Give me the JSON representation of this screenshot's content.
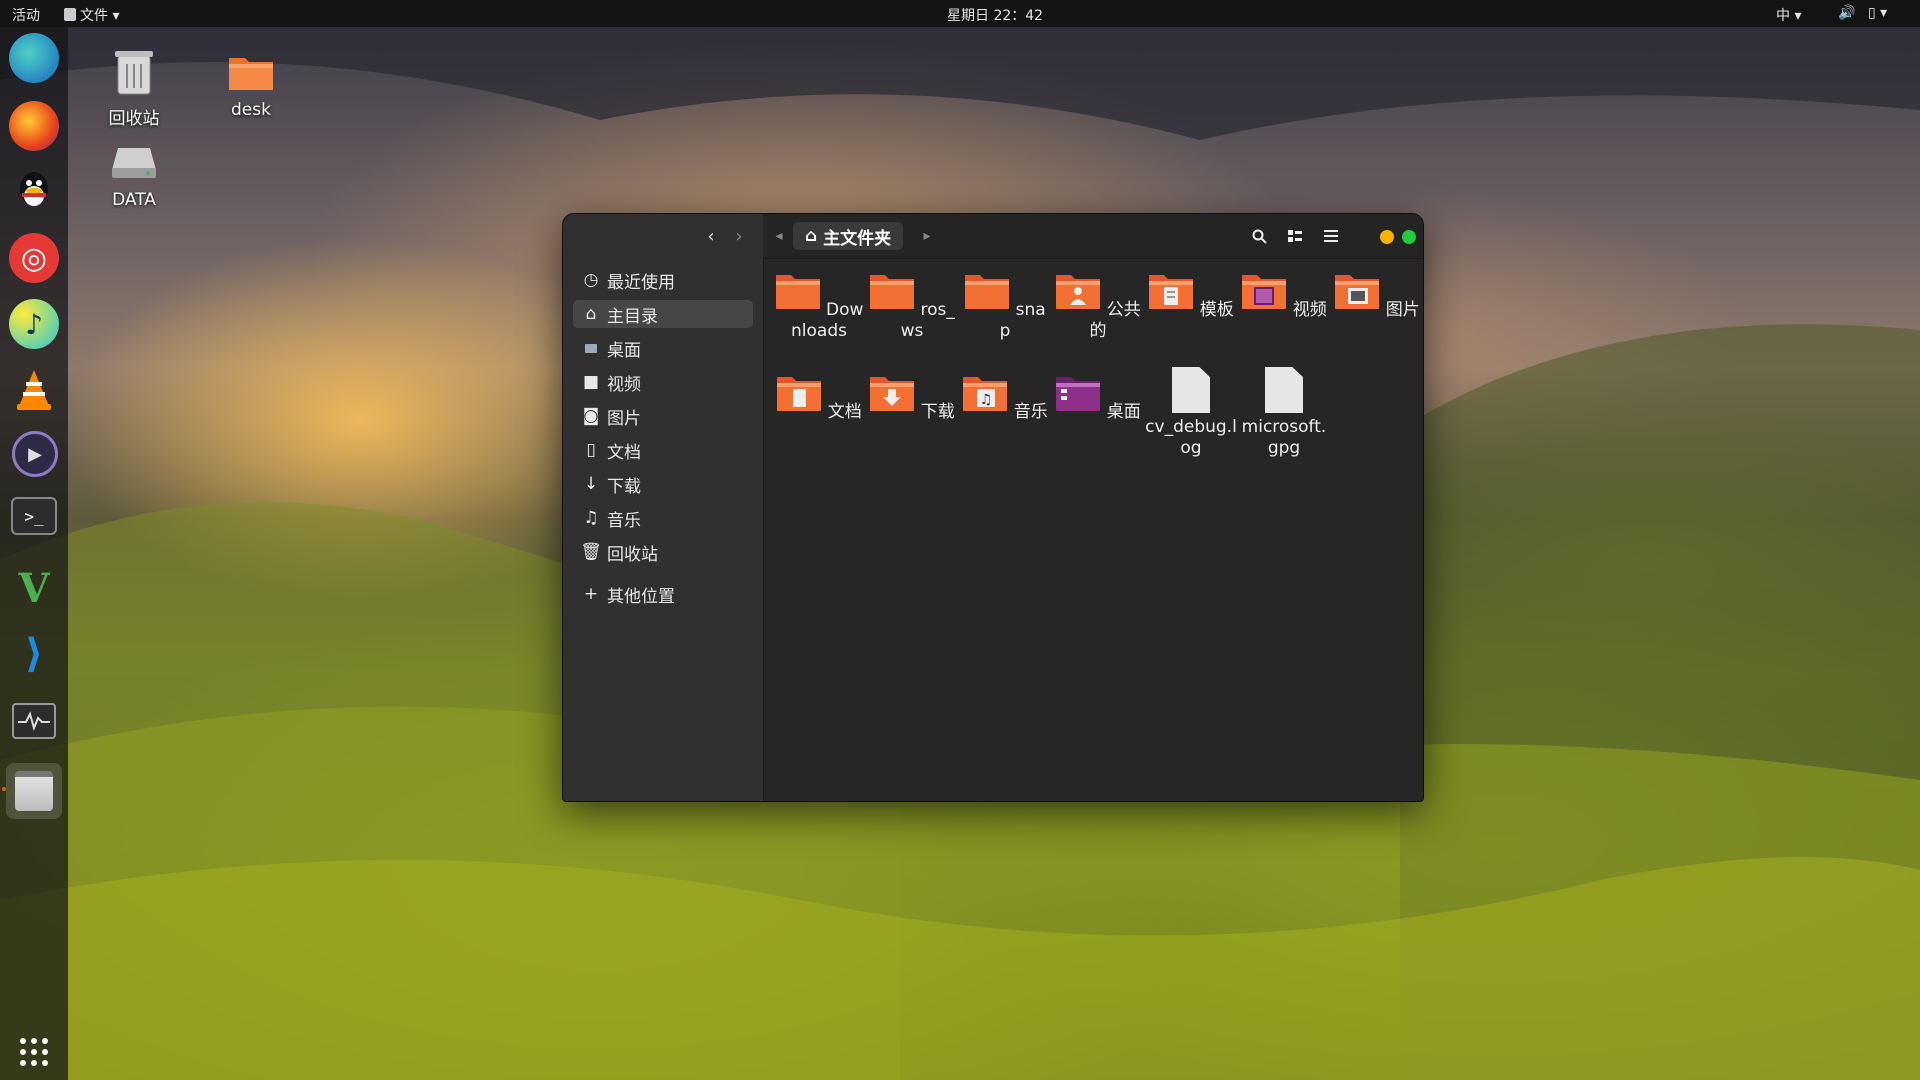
{
  "topbar": {
    "activities": "活动",
    "app_menu": "文件",
    "clock": "星期日 22：42",
    "input_method": "中"
  },
  "desktop_icons": [
    {
      "label": "回收站",
      "icon": "trash-icon"
    },
    {
      "label": "desk",
      "icon": "folder-icon"
    },
    {
      "label": "DATA",
      "icon": "drive-icon"
    }
  ],
  "dock": [
    {
      "name": "edge-icon"
    },
    {
      "name": "firefox-icon"
    },
    {
      "name": "qq-icon"
    },
    {
      "name": "netease-music-icon"
    },
    {
      "name": "music-player-icon"
    },
    {
      "name": "vlc-icon"
    },
    {
      "name": "video-player-icon"
    },
    {
      "name": "terminal-icon"
    },
    {
      "name": "vim-icon"
    },
    {
      "name": "vscode-icon"
    },
    {
      "name": "system-monitor-icon"
    },
    {
      "name": "file-manager-icon"
    },
    {
      "name": "app-grid-icon"
    }
  ],
  "window": {
    "path_label": "主文件夹",
    "sidebar": [
      {
        "label": "最近使用",
        "icon": "clock-icon"
      },
      {
        "label": "主目录",
        "icon": "home-icon",
        "active": true
      },
      {
        "label": "桌面",
        "icon": "folder-icon"
      },
      {
        "label": "视频",
        "icon": "video-icon"
      },
      {
        "label": "图片",
        "icon": "camera-icon"
      },
      {
        "label": "文档",
        "icon": "document-icon"
      },
      {
        "label": "下载",
        "icon": "download-icon"
      },
      {
        "label": "音乐",
        "icon": "music-icon"
      },
      {
        "label": "回收站",
        "icon": "trash-icon"
      },
      {
        "label": "其他位置",
        "icon": "plus-icon"
      }
    ],
    "files": [
      {
        "label": "Downloads",
        "type": "folder"
      },
      {
        "label": "ros_ws",
        "type": "folder"
      },
      {
        "label": "snap",
        "type": "folder"
      },
      {
        "label": "公共的",
        "type": "folder-public"
      },
      {
        "label": "模板",
        "type": "folder-templates"
      },
      {
        "label": "视频",
        "type": "folder-videos"
      },
      {
        "label": "图片",
        "type": "folder-pictures"
      },
      {
        "label": "文档",
        "type": "folder-documents"
      },
      {
        "label": "下载",
        "type": "folder-download"
      },
      {
        "label": "音乐",
        "type": "folder-music"
      },
      {
        "label": "桌面",
        "type": "folder-desktop"
      },
      {
        "label": "cv_debug.log",
        "type": "file"
      },
      {
        "label": "microsoft.gpg",
        "type": "file"
      }
    ]
  },
  "colors": {
    "folder": "#f0702e",
    "folder_top": "#f7a26a",
    "desktop_folder": "#8e2f8a",
    "close": "#e74c3c",
    "minimize": "#f4b400",
    "maximize": "#27c93f"
  }
}
